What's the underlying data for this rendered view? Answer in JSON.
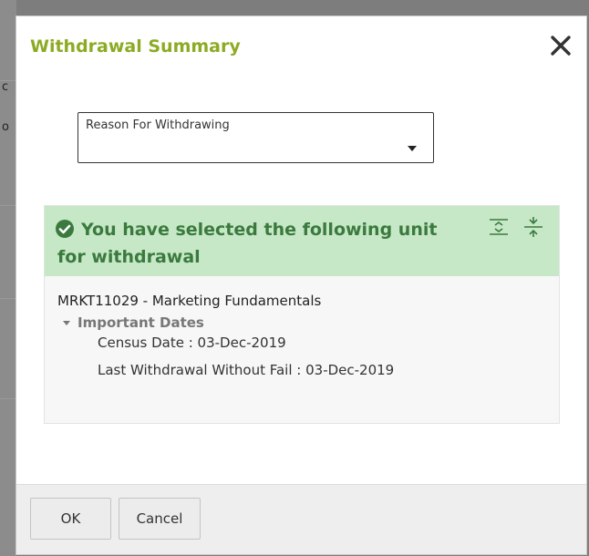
{
  "background": {
    "fragments": [
      "c",
      "o"
    ]
  },
  "dialog": {
    "title": "Withdrawal Summary",
    "close_icon": "close-icon",
    "title_color": "#8cab23"
  },
  "reason_select": {
    "label": "Reason For Withdrawing",
    "selected_value": "",
    "icon": "caret-down-icon"
  },
  "selection_panel": {
    "header_text": "You have selected the following unit for withdrawal",
    "header_bg": "#c6e8c7",
    "header_text_color": "#3b7a3e",
    "icons": [
      "check-circle-icon",
      "expand-all-icon",
      "collapse-all-icon"
    ],
    "unit": "MRKT11029 - Marketing Fundamentals",
    "important_dates_label": "Important Dates",
    "census_date": "Census Date : 03-Dec-2019",
    "last_withdrawal": "Last Withdrawal Without Fail : 03-Dec-2019"
  },
  "footer": {
    "ok_label": "OK",
    "cancel_label": "Cancel"
  }
}
